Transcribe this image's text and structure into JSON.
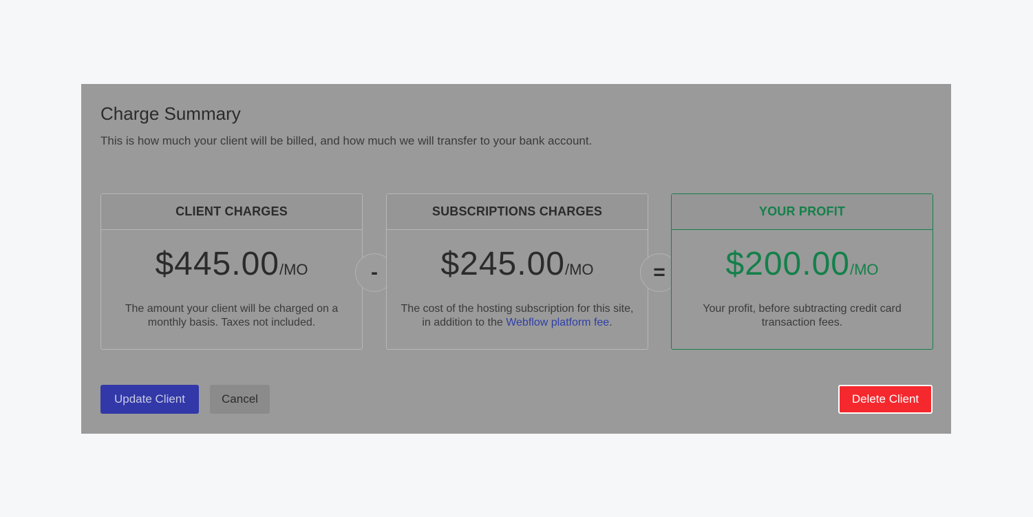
{
  "summary": {
    "title": "Charge Summary",
    "description": "This is how much your client will be billed, and how much we will transfer to your bank account."
  },
  "cards": {
    "client": {
      "header": "CLIENT CHARGES",
      "amount": "$445.00",
      "per": "/MO",
      "note": "The amount your client will be charged on a monthly basis. Taxes not included."
    },
    "subscriptions": {
      "header": "SUBSCRIPTIONS CHARGES",
      "amount": "$245.00",
      "per": "/MO",
      "note_before": "The cost of the hosting subscription for this site, in addition to the ",
      "note_link": "Webflow platform fee",
      "note_after": "."
    },
    "profit": {
      "header": "YOUR PROFIT",
      "amount": "$200.00",
      "per": "/MO",
      "note": "Your profit, before subtracting credit card transaction fees."
    }
  },
  "operators": {
    "minus": "-",
    "equals": "="
  },
  "actions": {
    "update_label": "Update Client",
    "cancel_label": "Cancel",
    "delete_label": "Delete Client"
  },
  "colors": {
    "profit_accent": "#14804a",
    "primary_button": "#3238a8",
    "danger_button": "#f4282d",
    "link": "#2f3fa8"
  }
}
